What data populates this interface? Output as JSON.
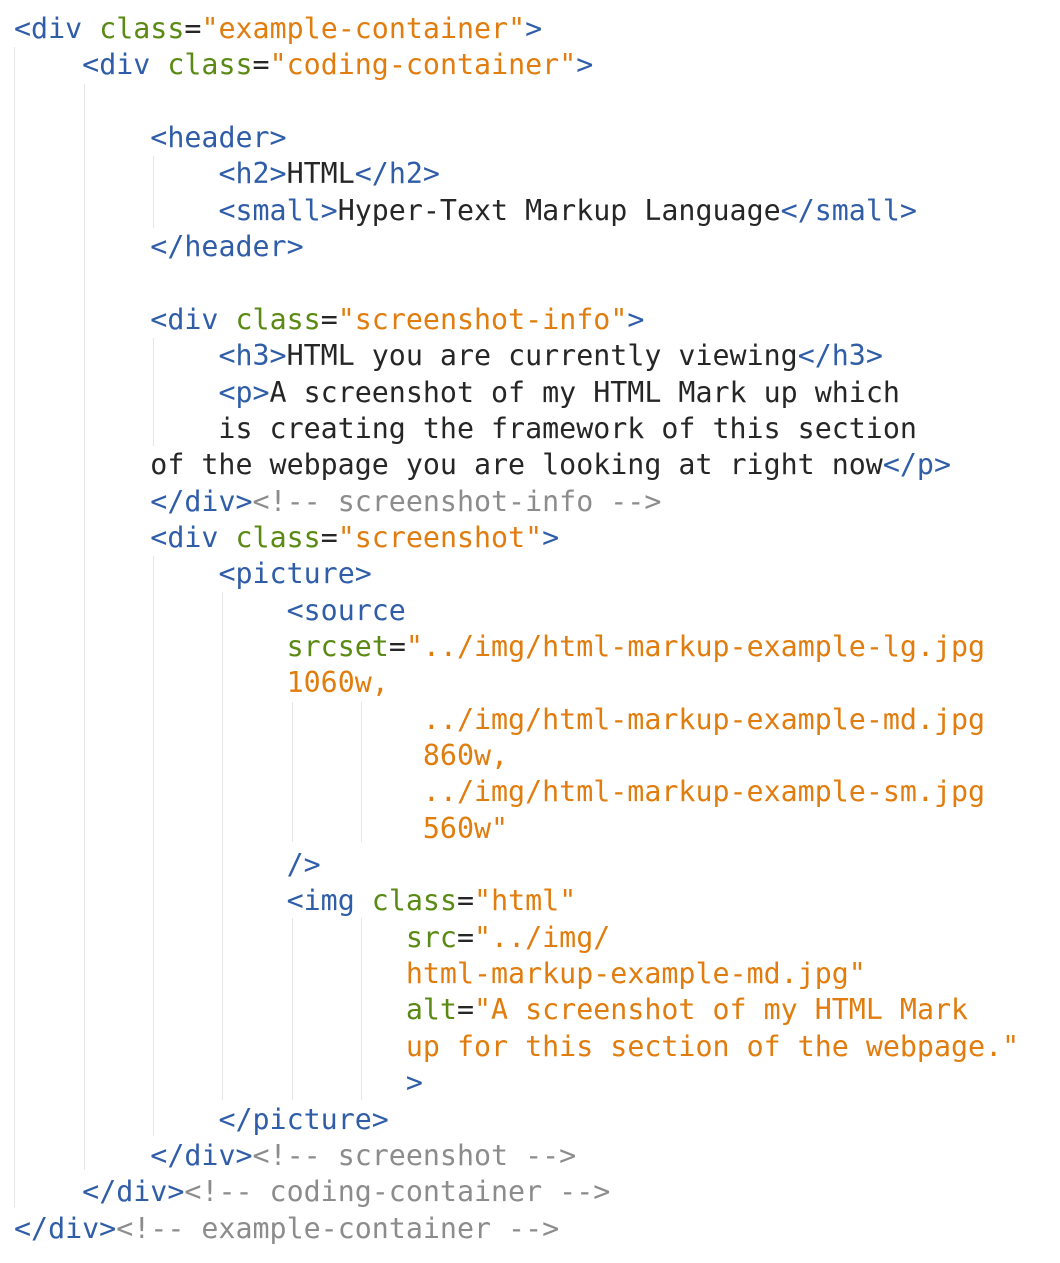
{
  "theme": {
    "background": "#ffffff",
    "tag_color": "#2f5da8",
    "attribute_color": "#5a8a14",
    "string_color": "#e07d0e",
    "text_color": "#262626",
    "comment_color": "#8c8c8c",
    "guide_color": "#e6e6e6"
  },
  "code": {
    "lines": [
      [
        {
          "t": "tag",
          "v": "<div"
        },
        {
          "t": "text",
          "v": " "
        },
        {
          "t": "attr",
          "v": "class"
        },
        {
          "t": "punct",
          "v": "="
        },
        {
          "t": "str",
          "v": "\"example-container\""
        },
        {
          "t": "tag",
          "v": ">"
        }
      ],
      [
        {
          "t": "text",
          "v": "    "
        },
        {
          "t": "tag",
          "v": "<div"
        },
        {
          "t": "text",
          "v": " "
        },
        {
          "t": "attr",
          "v": "class"
        },
        {
          "t": "punct",
          "v": "="
        },
        {
          "t": "str",
          "v": "\"coding-container\""
        },
        {
          "t": "tag",
          "v": ">"
        }
      ],
      [],
      [
        {
          "t": "text",
          "v": "        "
        },
        {
          "t": "tag",
          "v": "<header>"
        }
      ],
      [
        {
          "t": "text",
          "v": "            "
        },
        {
          "t": "tag",
          "v": "<h2>"
        },
        {
          "t": "text",
          "v": "HTML"
        },
        {
          "t": "tag",
          "v": "</h2>"
        }
      ],
      [
        {
          "t": "text",
          "v": "            "
        },
        {
          "t": "tag",
          "v": "<small>"
        },
        {
          "t": "text",
          "v": "Hyper-Text Markup Language"
        },
        {
          "t": "tag",
          "v": "</small>"
        }
      ],
      [
        {
          "t": "text",
          "v": "        "
        },
        {
          "t": "tag",
          "v": "</header>"
        }
      ],
      [],
      [
        {
          "t": "text",
          "v": "        "
        },
        {
          "t": "tag",
          "v": "<div"
        },
        {
          "t": "text",
          "v": " "
        },
        {
          "t": "attr",
          "v": "class"
        },
        {
          "t": "punct",
          "v": "="
        },
        {
          "t": "str",
          "v": "\"screenshot-info\""
        },
        {
          "t": "tag",
          "v": ">"
        }
      ],
      [
        {
          "t": "text",
          "v": "            "
        },
        {
          "t": "tag",
          "v": "<h3>"
        },
        {
          "t": "text",
          "v": "HTML you are currently viewing"
        },
        {
          "t": "tag",
          "v": "</h3>"
        }
      ],
      [
        {
          "t": "text",
          "v": "            "
        },
        {
          "t": "tag",
          "v": "<p>"
        },
        {
          "t": "text",
          "v": "A screenshot of my HTML Mark up which"
        }
      ],
      [
        {
          "t": "text",
          "v": "            is creating the framework of this section"
        }
      ],
      [
        {
          "t": "text",
          "v": "        of the webpage you are looking at right now"
        },
        {
          "t": "tag",
          "v": "</p>"
        }
      ],
      [
        {
          "t": "text",
          "v": "        "
        },
        {
          "t": "tag",
          "v": "</div>"
        },
        {
          "t": "comment",
          "v": "<!-- screenshot-info -->"
        }
      ],
      [
        {
          "t": "text",
          "v": "        "
        },
        {
          "t": "tag",
          "v": "<div"
        },
        {
          "t": "text",
          "v": " "
        },
        {
          "t": "attr",
          "v": "class"
        },
        {
          "t": "punct",
          "v": "="
        },
        {
          "t": "str",
          "v": "\"screenshot\""
        },
        {
          "t": "tag",
          "v": ">"
        }
      ],
      [
        {
          "t": "text",
          "v": "            "
        },
        {
          "t": "tag",
          "v": "<picture>"
        }
      ],
      [
        {
          "t": "text",
          "v": "                "
        },
        {
          "t": "tag",
          "v": "<source"
        }
      ],
      [
        {
          "t": "text",
          "v": "                "
        },
        {
          "t": "attr",
          "v": "srcset"
        },
        {
          "t": "punct",
          "v": "="
        },
        {
          "t": "str",
          "v": "\"../img/html-markup-example-lg.jpg"
        }
      ],
      [
        {
          "t": "text",
          "v": "                "
        },
        {
          "t": "str",
          "v": "1060w,"
        }
      ],
      [
        {
          "t": "text",
          "v": "                        "
        },
        {
          "t": "str",
          "v": "../img/html-markup-example-md.jpg"
        }
      ],
      [
        {
          "t": "text",
          "v": "                        "
        },
        {
          "t": "str",
          "v": "860w,"
        }
      ],
      [
        {
          "t": "text",
          "v": "                        "
        },
        {
          "t": "str",
          "v": "../img/html-markup-example-sm.jpg"
        }
      ],
      [
        {
          "t": "text",
          "v": "                        "
        },
        {
          "t": "str",
          "v": "560w\""
        }
      ],
      [
        {
          "t": "text",
          "v": "                "
        },
        {
          "t": "tag",
          "v": "/>"
        }
      ],
      [
        {
          "t": "text",
          "v": "                "
        },
        {
          "t": "tag",
          "v": "<img"
        },
        {
          "t": "text",
          "v": " "
        },
        {
          "t": "attr",
          "v": "class"
        },
        {
          "t": "punct",
          "v": "="
        },
        {
          "t": "str",
          "v": "\"html\""
        }
      ],
      [
        {
          "t": "text",
          "v": "                       "
        },
        {
          "t": "attr",
          "v": "src"
        },
        {
          "t": "punct",
          "v": "="
        },
        {
          "t": "str",
          "v": "\"../img/"
        }
      ],
      [
        {
          "t": "text",
          "v": "                       "
        },
        {
          "t": "str",
          "v": "html-markup-example-md.jpg\""
        }
      ],
      [
        {
          "t": "text",
          "v": "                       "
        },
        {
          "t": "attr",
          "v": "alt"
        },
        {
          "t": "punct",
          "v": "="
        },
        {
          "t": "str",
          "v": "\"A screenshot of my HTML Mark"
        }
      ],
      [
        {
          "t": "text",
          "v": "                       "
        },
        {
          "t": "str",
          "v": "up for this section of the webpage.\""
        }
      ],
      [
        {
          "t": "text",
          "v": "                       "
        },
        {
          "t": "tag",
          "v": ">"
        }
      ],
      [
        {
          "t": "text",
          "v": "            "
        },
        {
          "t": "tag",
          "v": "</picture>"
        }
      ],
      [
        {
          "t": "text",
          "v": "        "
        },
        {
          "t": "tag",
          "v": "</div>"
        },
        {
          "t": "comment",
          "v": "<!-- screenshot -->"
        }
      ],
      [
        {
          "t": "text",
          "v": "    "
        },
        {
          "t": "tag",
          "v": "</div>"
        },
        {
          "t": "comment",
          "v": "<!-- coding-container -->"
        }
      ],
      [
        {
          "t": "tag",
          "v": "</div>"
        },
        {
          "t": "comment",
          "v": "<!-- example-container -->"
        }
      ]
    ]
  }
}
